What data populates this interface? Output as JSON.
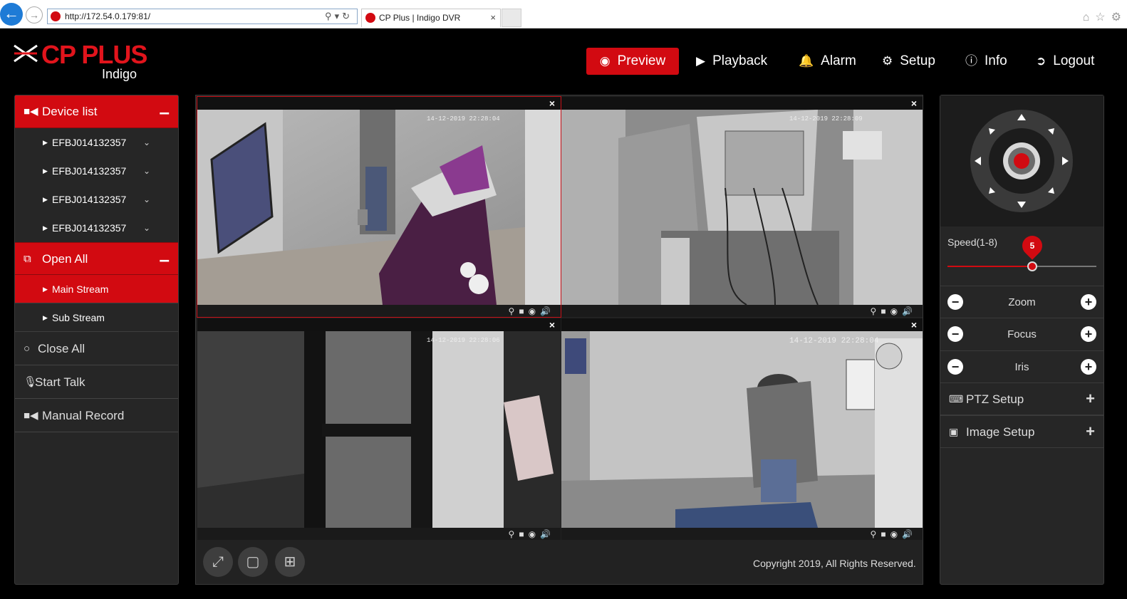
{
  "browser": {
    "url": "http://172.54.0.179:81/",
    "tab_title": "CP Plus | Indigo DVR",
    "tab_close": "×"
  },
  "header": {
    "logo_text": "CP PLUS",
    "logo_sub": "Indigo",
    "nav": [
      {
        "label": "Preview",
        "active": true
      },
      {
        "label": "Playback"
      },
      {
        "label": "Alarm"
      },
      {
        "label": "Setup"
      },
      {
        "label": "Info"
      },
      {
        "label": "Logout"
      }
    ]
  },
  "sidebar": {
    "device_list_label": "Device list",
    "devices": [
      "EFBJ014132357",
      "EFBJ014132357",
      "EFBJ014132357",
      "EFBJ014132357"
    ],
    "open_all_label": "Open All",
    "streams": [
      {
        "label": "Main Stream",
        "selected": true
      },
      {
        "label": "Sub Stream"
      }
    ],
    "close_all_label": "Close All",
    "start_talk_label": "Start Talk",
    "manual_record_label": "Manual Record"
  },
  "video": {
    "cells": [
      {
        "timestamp": "14-12-2019 22:28:04",
        "close": "×"
      },
      {
        "timestamp": "14-12-2019 22:28:09",
        "close": "×"
      },
      {
        "timestamp": "14-12-2019 22:28:06",
        "close": "×"
      },
      {
        "timestamp": "14-12-2019 22:28:04",
        "close": "×"
      }
    ],
    "copyright": "Copyright 2019, All Rights Reserved."
  },
  "ptz": {
    "speed_label": "Speed(1-8)",
    "speed_value": "5",
    "speed_fraction": 0.5714,
    "rows": [
      {
        "label": "Zoom"
      },
      {
        "label": "Focus"
      },
      {
        "label": "Iris"
      }
    ],
    "ptz_setup_label": "PTZ Setup",
    "image_setup_label": "Image Setup",
    "accent_color": "#d20a11"
  }
}
